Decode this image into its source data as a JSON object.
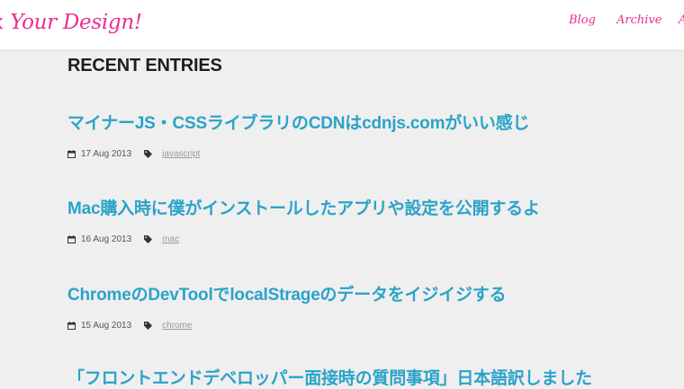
{
  "header": {
    "logo_text": "ck Your Design!",
    "nav": [
      "Blog",
      "Archive",
      "A"
    ]
  },
  "main": {
    "section_title": "RECENT ENTRIES",
    "entries": [
      {
        "title": "マイナーJS・CSSライブラリのCDNはcdnjs.comがいい感じ",
        "date": "17 Aug 2013",
        "tag": "javascript"
      },
      {
        "title": "Mac購入時に僕がインストールしたアプリや設定を公開するよ",
        "date": "16 Aug 2013",
        "tag": "mac"
      },
      {
        "title": "ChromeのDevToolでlocalStrageのデータをイジイジする",
        "date": "15 Aug 2013",
        "tag": "chrome"
      },
      {
        "title": "「フロントエンドデベロッパー面接時の質問事項」日本語訳しました"
      }
    ]
  },
  "icons": {
    "date": "calendar-icon",
    "tag": "tag-icon"
  },
  "colors": {
    "brand": "#e8308f",
    "link": "#2aa3c8",
    "heading": "#1d1d1d",
    "background": "#efefef"
  }
}
